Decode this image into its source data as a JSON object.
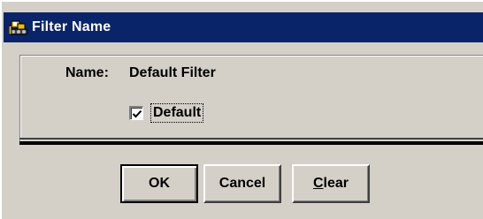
{
  "window": {
    "title": "Filter Name",
    "title_icon": "bulldozer-app-icon",
    "titlebar_color": "#0a246a",
    "background_color": "#d4d0c8"
  },
  "form": {
    "name_label": "Name:",
    "name_value": "Default Filter",
    "default_checkbox": {
      "label": "Default",
      "checked": true
    }
  },
  "buttons": {
    "ok_label": "OK",
    "cancel_label": "Cancel",
    "clear_label_prefix": "C",
    "clear_label_rest": "lear"
  }
}
